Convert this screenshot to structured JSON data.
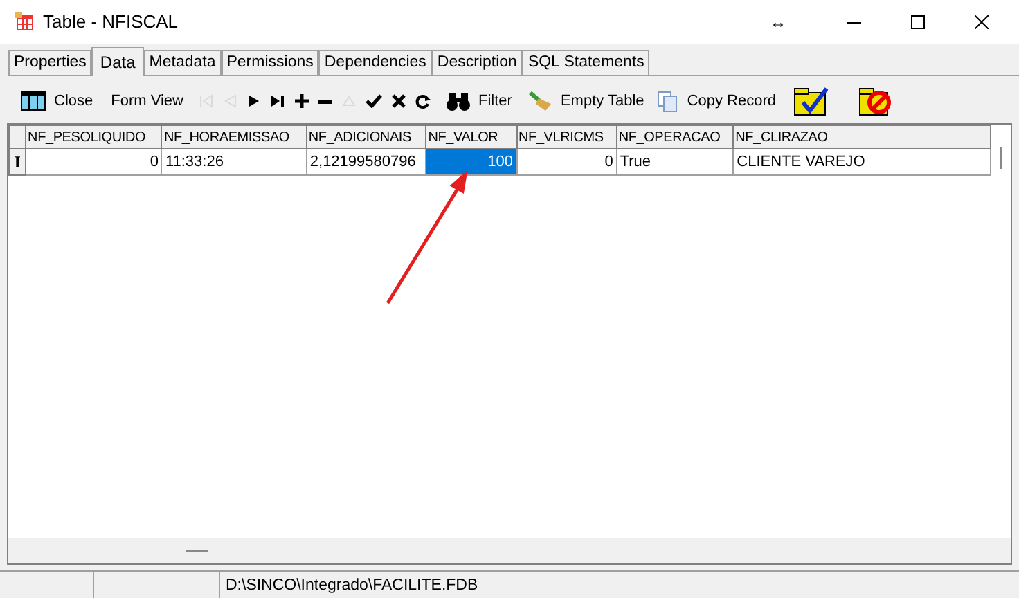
{
  "window": {
    "title": "Table - NFISCAL",
    "resize_glyph": "↔"
  },
  "tabs": [
    {
      "label": "Properties",
      "selected": false
    },
    {
      "label": "Data",
      "selected": true
    },
    {
      "label": "Metadata",
      "selected": false
    },
    {
      "label": "Permissions",
      "selected": false
    },
    {
      "label": "Dependencies",
      "selected": false
    },
    {
      "label": "Description",
      "selected": false
    },
    {
      "label": "SQL Statements",
      "selected": false
    }
  ],
  "toolbar": [
    {
      "label": "Close",
      "disabled": false
    },
    {
      "label": "Form View",
      "disabled": false
    },
    {
      "disabled": true
    },
    {
      "disabled": true
    },
    {
      "disabled": false
    },
    {
      "disabled": false
    },
    {
      "disabled": false
    },
    {
      "disabled": false
    },
    {
      "disabled": true
    },
    {
      "disabled": false
    },
    {
      "disabled": false
    },
    {
      "disabled": false
    },
    {
      "label": "Filter",
      "disabled": false
    },
    {
      "label": "Empty Table",
      "disabled": false
    },
    {
      "label": "Copy Record",
      "disabled": false
    },
    {
      "disabled": false
    },
    {
      "disabled": false
    }
  ],
  "table": {
    "columns": [
      "NF_PESOLIQUIDO",
      "NF_HORAEMISSAO",
      "NF_ADICIONAIS",
      "NF_VALOR",
      "NF_VLRICMS",
      "NF_OPERACAO",
      "NF_CLIRAZAO"
    ],
    "rows": [
      {
        "indicator": "I",
        "cells": [
          {
            "text": "0",
            "kind": "number",
            "selected": false
          },
          {
            "text": "11:33:26",
            "kind": "text",
            "selected": false
          },
          {
            "text": "2,12199580796",
            "kind": "text",
            "selected": false
          },
          {
            "text": "100",
            "kind": "number",
            "selected": true
          },
          {
            "text": "0",
            "kind": "number",
            "selected": false
          },
          {
            "text": "True",
            "kind": "text",
            "selected": false
          },
          {
            "text": "CLIENTE VAREJO",
            "kind": "text",
            "selected": false
          }
        ]
      }
    ]
  },
  "status_bar": {
    "path": "D:\\SINCO\\Integrado\\FACILITE.FDB"
  }
}
